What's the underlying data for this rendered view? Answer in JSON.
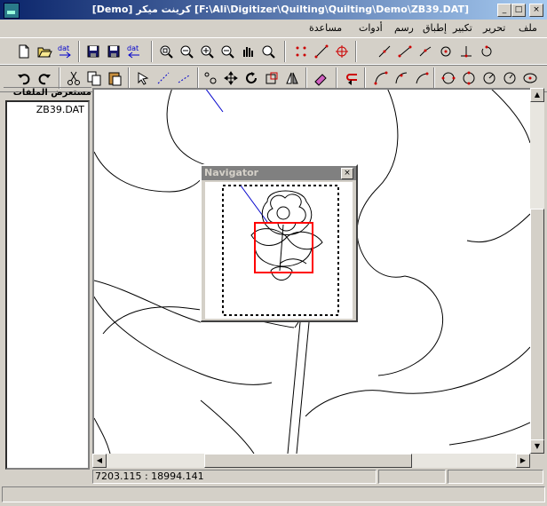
{
  "window": {
    "title": "[Demo] كرينت ميكر [F:\\Ali\\Digitizer\\Quilting\\Quilting\\Demo\\ZB39.DAT]",
    "minimize": "_",
    "maximize": "□",
    "close": "×"
  },
  "menu": {
    "items": [
      "ملف",
      "تحرير",
      "تكبير",
      "إطباق",
      "رسم",
      "أدوات",
      "مساعدة"
    ]
  },
  "toolbar1": {
    "icons": [
      "new-file-icon",
      "open-folder-icon",
      "import-dat-icon",
      "save-icon",
      "save-as-icon",
      "export-dat-icon",
      "zoom-window-icon",
      "zoom-fit-icon",
      "zoom-in-icon",
      "zoom-out-icon",
      "pan-icon",
      "zoom-previous-icon",
      "points-icon",
      "line-arrow-icon",
      "target-icon",
      "scissors-line-icon",
      "segment-icon",
      "polyline-icon",
      "circle-point-icon",
      "perpendicular-icon",
      "rotate-point-icon"
    ],
    "dat_label": "dat"
  },
  "toolbar2": {
    "icons": [
      "undo-icon",
      "redo-icon",
      "cut-icon",
      "copy-icon",
      "paste-icon",
      "select-arrow-icon",
      "dotted-line-icon",
      "dotted-diagonal-icon",
      "node-edit-icon",
      "move-icon",
      "rotate-icon",
      "scale-icon",
      "mirror-icon",
      "eraser-icon",
      "reverse-icon",
      "arc-icon",
      "arc-2-icon",
      "arc-3-icon",
      "circle-icon",
      "circle-2-icon",
      "circle-3-icon",
      "circle-4-icon",
      "ellipse-icon"
    ]
  },
  "file_browser": {
    "title": "مستعرض الملفات",
    "files": [
      "ZB39.DAT"
    ]
  },
  "navigator": {
    "title": "Navigator",
    "close": "×"
  },
  "status": {
    "coordinates": "7203.115 : 18994.141"
  },
  "colors": {
    "title_start": "#0a246a",
    "title_end": "#a6caf0",
    "viewport_rect": "#ff0000",
    "design_stroke": "#000000",
    "accent_line": "#0000cc"
  }
}
